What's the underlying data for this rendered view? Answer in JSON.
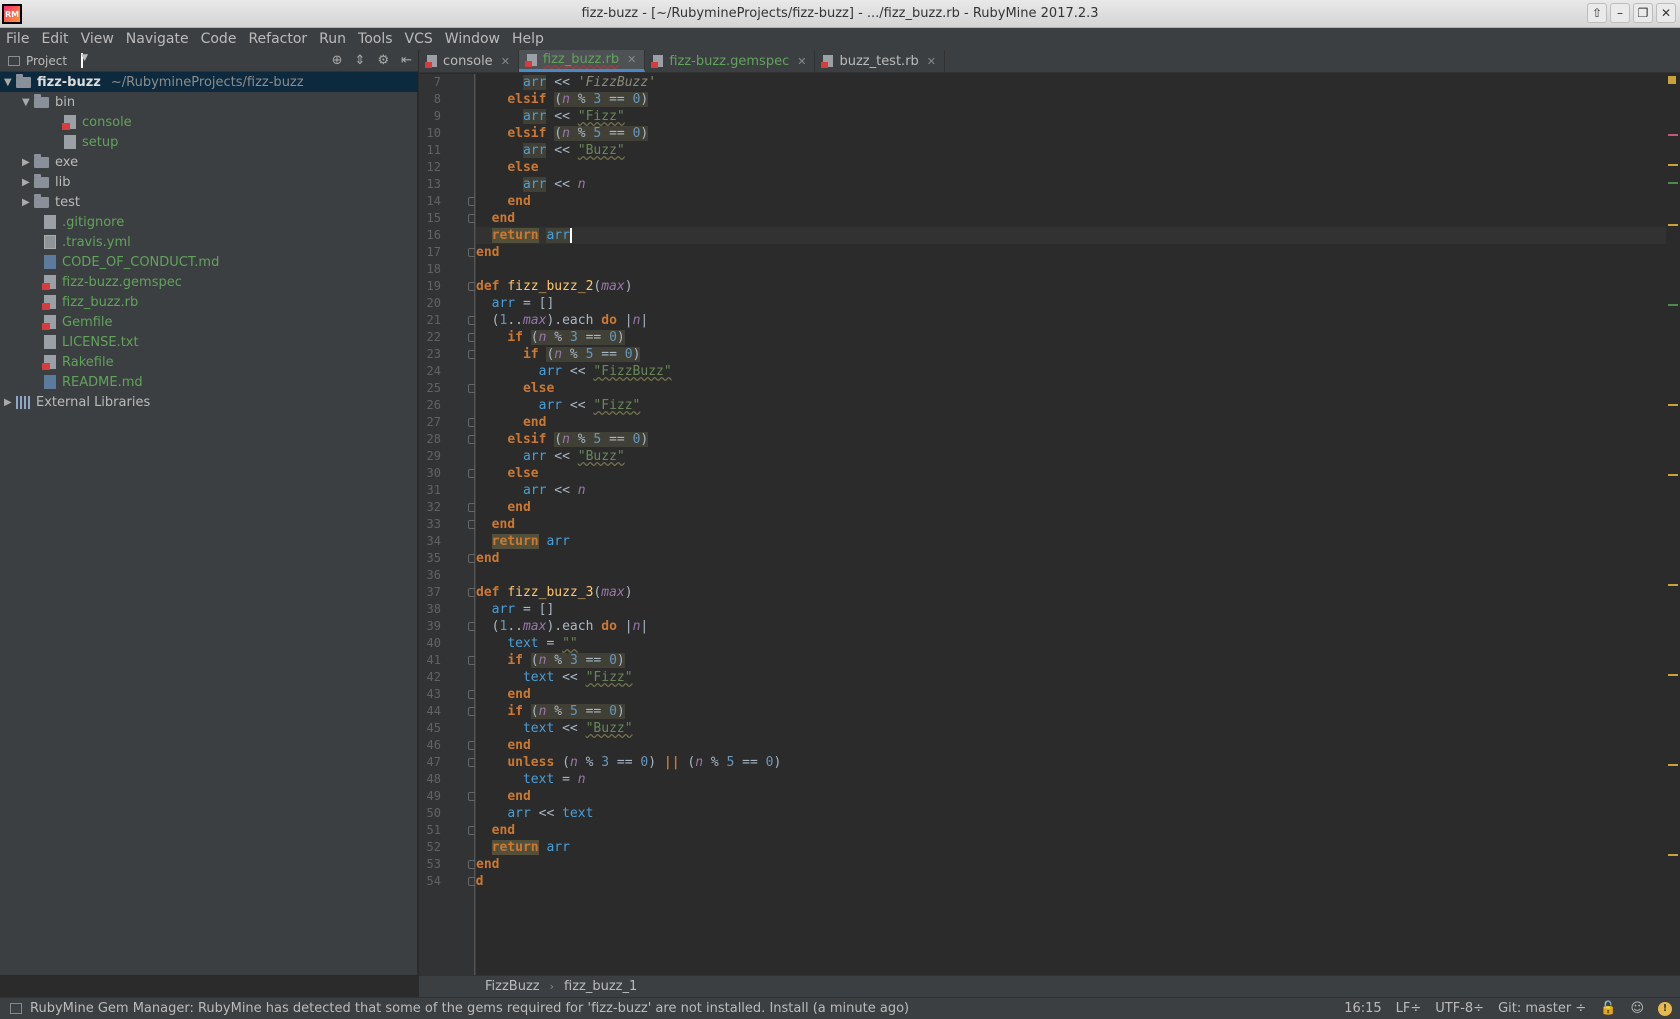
{
  "window": {
    "title": "fizz-buzz - [~/RubymineProjects/fizz-buzz] - .../fizz_buzz.rb - RubyMine 2017.2.3",
    "app_icon_text": "RM"
  },
  "menu": [
    "File",
    "Edit",
    "View",
    "Navigate",
    "Code",
    "Refactor",
    "Run",
    "Tools",
    "VCS",
    "Window",
    "Help"
  ],
  "project_panel": {
    "title": "Project"
  },
  "tree": {
    "root_name": "fizz-buzz",
    "root_path": "~/RubymineProjects/fizz-buzz",
    "bin": "bin",
    "console": "console",
    "setup": "setup",
    "exe": "exe",
    "lib": "lib",
    "test": "test",
    "gitignore": ".gitignore",
    "travis": ".travis.yml",
    "coc": "CODE_OF_CONDUCT.md",
    "gemspec": "fizz-buzz.gemspec",
    "fizzbuzz_rb": "fizz_buzz.rb",
    "gemfile": "Gemfile",
    "license": "LICENSE.txt",
    "rakefile": "Rakefile",
    "readme": "README.md",
    "ext_libs": "External Libraries"
  },
  "tabs": [
    "console",
    "fizz_buzz.rb",
    "fizz-buzz.gemspec",
    "buzz_test.rb"
  ],
  "line_numbers": [
    "7",
    "8",
    "9",
    "10",
    "11",
    "12",
    "13",
    "14",
    "15",
    "16",
    "17",
    "18",
    "19",
    "20",
    "21",
    "22",
    "23",
    "24",
    "25",
    "26",
    "27",
    "28",
    "29",
    "30",
    "31",
    "32",
    "33",
    "34",
    "35",
    "36",
    "37",
    "38",
    "39",
    "40",
    "41",
    "42",
    "43",
    "44",
    "45",
    "46",
    "47",
    "48",
    "49",
    "50",
    "51",
    "52",
    "53",
    "54"
  ],
  "code": {
    "def": "def",
    "end": "end",
    "if": "if",
    "elsif": "elsif",
    "else": "else",
    "return": "return",
    "do": "do",
    "unless": "unless",
    "arr": "arr",
    "text": "text",
    "n": "n",
    "max": "max",
    "fn2": "fizz_buzz_2",
    "fn3": "fizz_buzz_3",
    "s_fizzbuzz_single": "'FizzBuzz'",
    "s_fizz": "\"Fizz\"",
    "s_buzz": "\"Buzz\"",
    "s_fizzbuzz": "\"FizzBuzz\"",
    "s_empty": "\"\"",
    "c3": "3",
    "c5": "5",
    "c0": "0",
    "c1": "1"
  },
  "breadcrumb": [
    "FizzBuzz",
    "fizz_buzz_1"
  ],
  "status": {
    "message": "RubyMine Gem Manager: RubyMine has detected that some of the gems required for 'fizz-buzz' are not installed. Install (a minute ago)",
    "position": "16:15",
    "line_sep": "LF÷",
    "encoding": "UTF-8÷",
    "git": "Git: master ÷"
  }
}
